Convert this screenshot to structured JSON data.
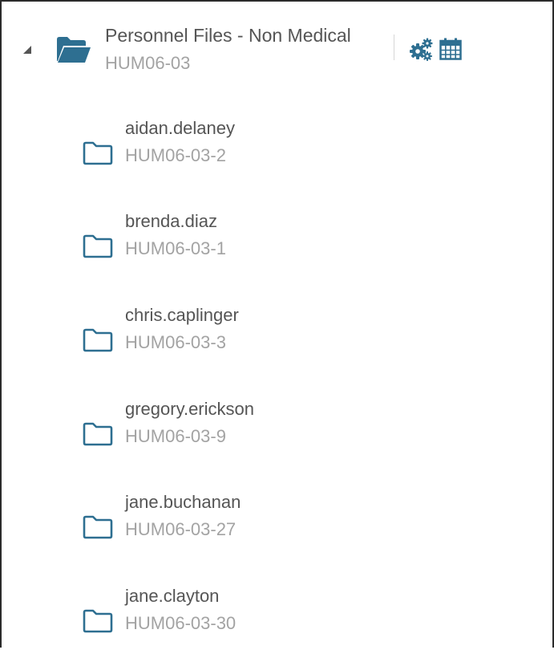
{
  "colors": {
    "accent": "#2e6f91",
    "title_text": "#555555",
    "code_text": "#a3a3a3",
    "border": "#2b2b2b"
  },
  "root": {
    "name": "Personnel Files - Non Medical",
    "code": "HUM06-03",
    "expanded": true,
    "toggle_icon": "triangle-expanded-icon",
    "folder_icon": "folder-open-icon",
    "actions": [
      {
        "icon": "gears-icon"
      },
      {
        "icon": "calendar-icon"
      }
    ]
  },
  "children": [
    {
      "name": "aidan.delaney",
      "code": "HUM06-03-2",
      "icon": "folder-closed-icon"
    },
    {
      "name": "brenda.diaz",
      "code": "HUM06-03-1",
      "icon": "folder-closed-icon"
    },
    {
      "name": "chris.caplinger",
      "code": "HUM06-03-3",
      "icon": "folder-closed-icon"
    },
    {
      "name": "gregory.erickson",
      "code": "HUM06-03-9",
      "icon": "folder-closed-icon"
    },
    {
      "name": "jane.buchanan",
      "code": "HUM06-03-27",
      "icon": "folder-closed-icon"
    },
    {
      "name": "jane.clayton",
      "code": "HUM06-03-30",
      "icon": "folder-closed-icon"
    }
  ]
}
